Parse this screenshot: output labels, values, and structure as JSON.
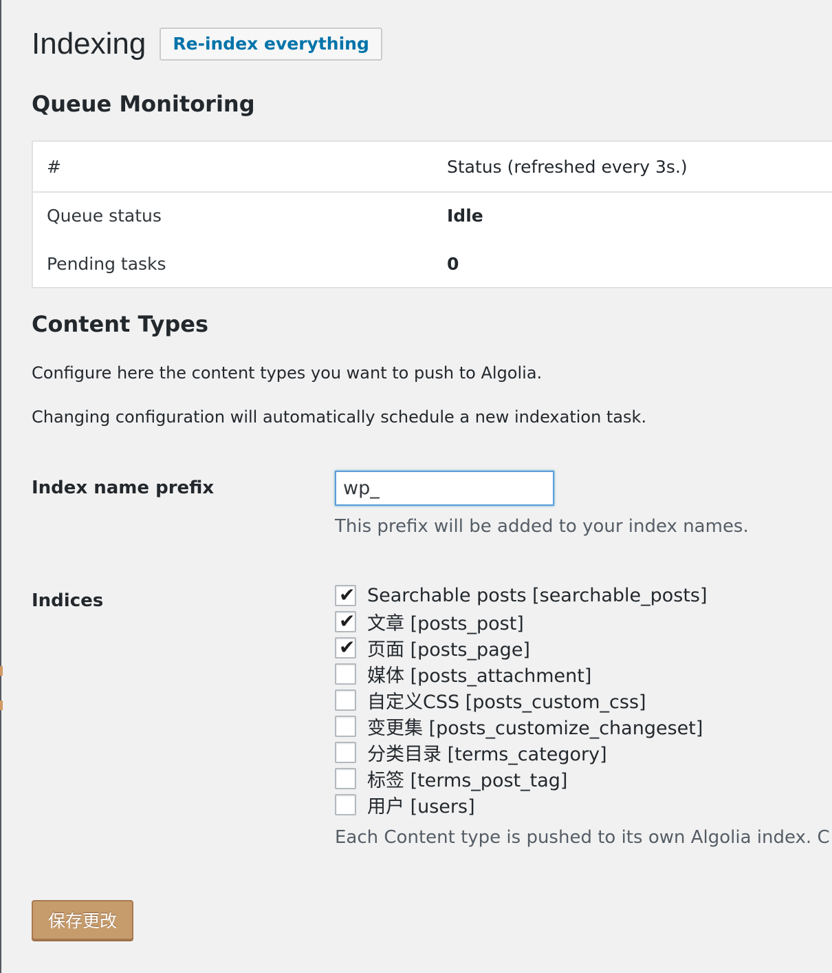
{
  "header": {
    "title": "Indexing",
    "reindex_button": "Re-index everything"
  },
  "queue": {
    "section_title": "Queue Monitoring",
    "columns": [
      "#",
      "Status (refreshed every 3s.)"
    ],
    "rows": [
      {
        "label": "Queue status",
        "value": "Idle"
      },
      {
        "label": "Pending tasks",
        "value": "0"
      }
    ]
  },
  "content_types": {
    "section_title": "Content Types",
    "description_1": "Configure here the content types you want to push to Algolia.",
    "description_2": "Changing configuration will automatically schedule a new indexation task."
  },
  "prefix_field": {
    "label": "Index name prefix",
    "value": "wp_",
    "help": "This prefix will be added to your index names."
  },
  "indices": {
    "label": "Indices",
    "items": [
      {
        "label": "Searchable posts [searchable_posts]",
        "checked": true
      },
      {
        "label": "文章 [posts_post]",
        "checked": true
      },
      {
        "label": "页面 [posts_page]",
        "checked": true
      },
      {
        "label": "媒体 [posts_attachment]",
        "checked": false
      },
      {
        "label": "自定义CSS [posts_custom_css]",
        "checked": false
      },
      {
        "label": "变更集 [posts_customize_changeset]",
        "checked": false
      },
      {
        "label": "分类目录 [terms_category]",
        "checked": false
      },
      {
        "label": "标签 [terms_post_tag]",
        "checked": false
      },
      {
        "label": "用户 [users]",
        "checked": false
      }
    ],
    "help": "Each Content type is pushed to its own Algolia index. C"
  },
  "save_button": "保存更改",
  "icons": {
    "checkmark": "✔"
  },
  "colors": {
    "background": "#f1f1f1",
    "link_blue": "#0073aa",
    "save_button": "#c69c6d",
    "focus_border": "#5b9dd9"
  }
}
